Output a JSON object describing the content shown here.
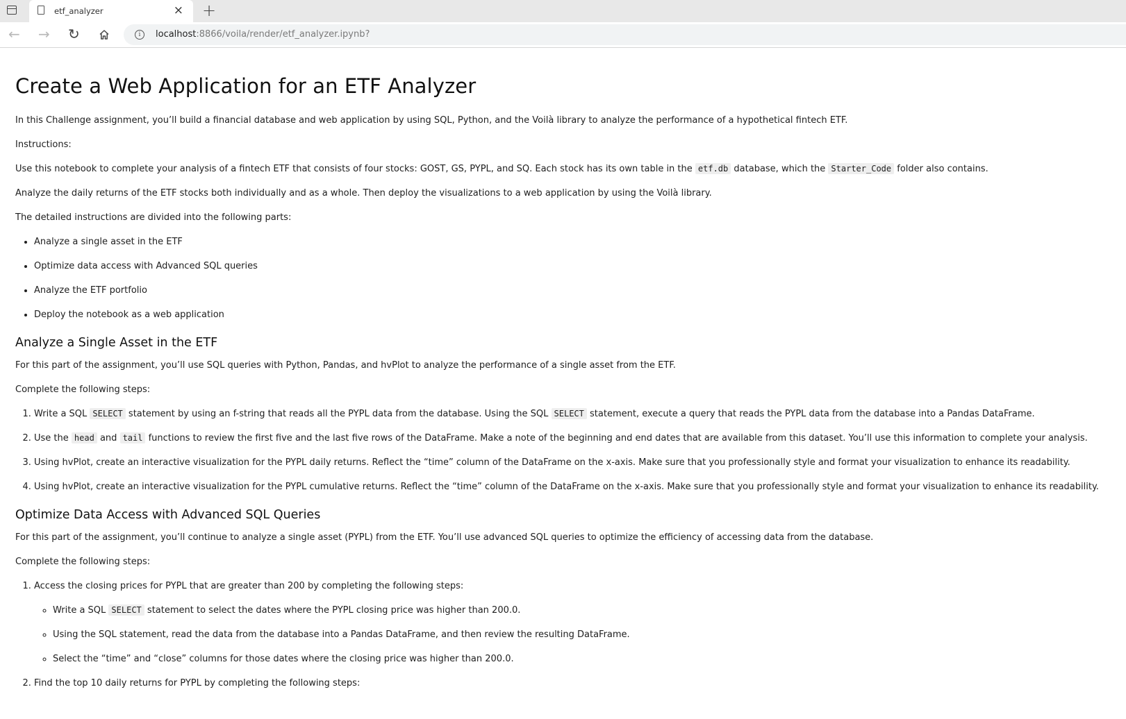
{
  "browser": {
    "tab_title": "etf_analyzer",
    "tab_close": "×",
    "new_tab": "+",
    "back": "←",
    "forward": "→",
    "reload": "↻",
    "info": "i",
    "url_host": "localhost",
    "url_rest": ":8866/voila/render/etf_analyzer.ipynb?"
  },
  "page": {
    "title": "Create a Web Application for an ETF Analyzer",
    "intro": "In this Challenge assignment, you’ll build a financial database and web application by using SQL, Python, and the Voilà library to analyze the performance of a hypothetical fintech ETF.",
    "instructions_label": "Instructions:",
    "p_use_a": "Use this notebook to complete your analysis of a fintech ETF that consists of four stocks: GOST, GS, PYPL, and SQ. Each stock has its own table in the",
    "code_etf_db": "etf.db",
    "p_use_b": "database, which the",
    "code_starter": "Starter_Code",
    "p_use_c": "folder also contains.",
    "p_analyze": "Analyze the daily returns of the ETF stocks both individually and as a whole. Then deploy the visualizations to a web application by using the Voilà library.",
    "p_parts": "The detailed instructions are divided into the following parts:",
    "parts": [
      "Analyze a single asset in the ETF",
      "Optimize data access with Advanced SQL queries",
      "Analyze the ETF portfolio",
      "Deploy the notebook as a web application"
    ],
    "section1": {
      "heading": "Analyze a Single Asset in the ETF",
      "intro": "For this part of the assignment, you’ll use SQL queries with Python, Pandas, and hvPlot to analyze the performance of a single asset from the ETF.",
      "steps_label": "Complete the following steps:",
      "step1_a": "Write a SQL",
      "step1_code1": "SELECT",
      "step1_b": "statement by using an f-string that reads all the PYPL data from the database. Using the SQL",
      "step1_code2": "SELECT",
      "step1_c": "statement, execute a query that reads the PYPL data from the database into a Pandas DataFrame.",
      "step2_a": "Use the",
      "step2_code1": "head",
      "step2_b": "and",
      "step2_code2": "tail",
      "step2_c": "functions to review the first five and the last five rows of the DataFrame. Make a note of the beginning and end dates that are available from this dataset. You’ll use this information to complete your analysis.",
      "step3": "Using hvPlot, create an interactive visualization for the PYPL daily returns. Reflect the “time” column of the DataFrame on the x-axis. Make sure that you professionally style and format your visualization to enhance its readability.",
      "step4": "Using hvPlot, create an interactive visualization for the PYPL cumulative returns. Reflect the “time” column of the DataFrame on the x-axis. Make sure that you professionally style and format your visualization to enhance its readability."
    },
    "section2": {
      "heading": "Optimize Data Access with Advanced SQL Queries",
      "intro": "For this part of the assignment, you’ll continue to analyze a single asset (PYPL) from the ETF. You’ll use advanced SQL queries to optimize the efficiency of accessing data from the database.",
      "steps_label": "Complete the following steps:",
      "step1": "Access the closing prices for PYPL that are greater than 200 by completing the following steps:",
      "sub1_a": "Write a SQL",
      "sub1_code": "SELECT",
      "sub1_b": "statement to select the dates where the PYPL closing price was higher than 200.0.",
      "sub2": "Using the SQL statement, read the data from the database into a Pandas DataFrame, and then review the resulting DataFrame.",
      "sub3": "Select the “time” and “close” columns for those dates where the closing price was higher than 200.0.",
      "step2": "Find the top 10 daily returns for PYPL by completing the following steps:"
    }
  }
}
